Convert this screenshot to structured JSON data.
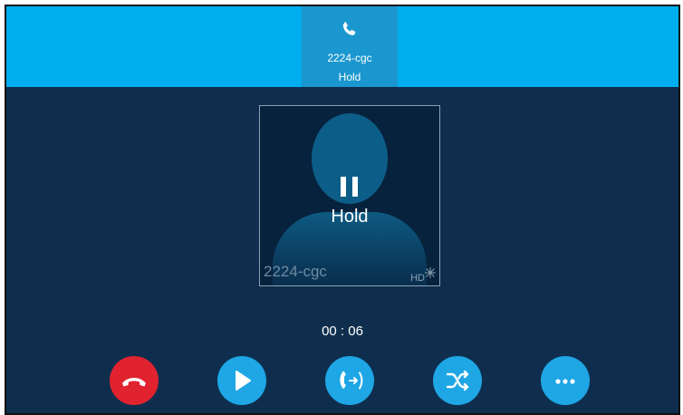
{
  "call": {
    "name": "2224-cgc",
    "state": "Hold",
    "timer": "00 : 06"
  },
  "avatar": {
    "name": "2224-cgc",
    "status": "Hold",
    "badge": "HD"
  },
  "buttons": [
    {
      "icon": "end-call-icon",
      "color": "#e0232e"
    },
    {
      "icon": "resume-play-icon",
      "color": "#1ea6e5"
    },
    {
      "icon": "transfer-icon",
      "color": "#1ea6e5"
    },
    {
      "icon": "swap-shuffle-icon",
      "color": "#1ea6e5"
    },
    {
      "icon": "more-dots-icon",
      "color": "#1ea6e5"
    }
  ],
  "colors": {
    "topbar": "#00aeef",
    "background": "#0f2e4e"
  }
}
